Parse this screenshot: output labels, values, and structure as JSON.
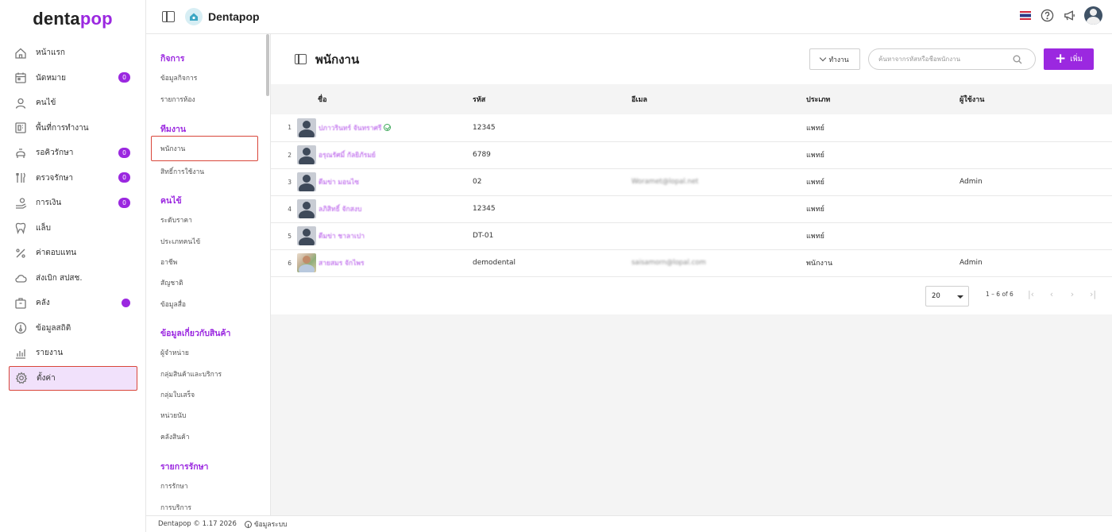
{
  "brand": {
    "logo_a": "denta",
    "logo_b": "pop"
  },
  "sidebar": {
    "items": [
      {
        "label": "หน้าแรก",
        "icon": "home-icon"
      },
      {
        "label": "นัดหมาย",
        "icon": "calendar-icon",
        "badge": "0"
      },
      {
        "label": "คนไข้",
        "icon": "user-icon"
      },
      {
        "label": "พื้นที่การทำงาน",
        "icon": "workspace-icon"
      },
      {
        "label": "รอคิวรักษา",
        "icon": "dental-chair-icon",
        "badge": "0"
      },
      {
        "label": "ตรวจรักษา",
        "icon": "tools-icon",
        "badge": "0"
      },
      {
        "label": "การเงิน",
        "icon": "payment-icon",
        "badge": "0"
      },
      {
        "label": "แล็บ",
        "icon": "tooth-icon"
      },
      {
        "label": "ค่าตอบแทน",
        "icon": "percent-icon"
      },
      {
        "label": "ส่งเบิก สปสช.",
        "icon": "cloud-icon"
      },
      {
        "label": "คลัง",
        "icon": "package-icon",
        "dot": true
      },
      {
        "label": "ข้อมูลสถิติ",
        "icon": "thermometer-icon"
      },
      {
        "label": "รายงาน",
        "icon": "report-icon"
      },
      {
        "label": "ตั้งค่า",
        "icon": "gear-icon",
        "active": true
      }
    ]
  },
  "topbar": {
    "clinic_name": "Dentapop"
  },
  "subnav": {
    "sections": [
      {
        "title": "กิจการ",
        "items": [
          "ข้อมูลกิจการ",
          "รายการห้อง"
        ]
      },
      {
        "title": "ทีมงาน",
        "items": [
          "พนักงาน",
          "สิทธิ์การใช้งาน"
        ]
      },
      {
        "title": "คนไข้",
        "items": [
          "ระดับราคา",
          "ประเภทคนไข้",
          "อาชีพ",
          "สัญชาติ",
          "ข้อมูลสื่อ"
        ]
      },
      {
        "title": "ข้อมูลเกี่ยวกับสินค้า",
        "items": [
          "ผู้จำหน่าย",
          "กลุ่มสินค้าและบริการ",
          "กลุ่มใบเสร็จ",
          "หน่วยนับ",
          "คลังสินค้า"
        ]
      },
      {
        "title": "รายการรักษา",
        "items": [
          "การรักษา",
          "การบริการ"
        ]
      }
    ]
  },
  "page": {
    "title": "พนักงาน",
    "filter_label": "ทำงาน",
    "search_placeholder": "ค้นหาจากรหัสหรือชื่อพนักงาน",
    "add_label": "เพิ่ม"
  },
  "table": {
    "headers": {
      "name": "ชื่อ",
      "code": "รหัส",
      "email": "อีเมล",
      "type": "ประเภท",
      "user": "ผู้ใช้งาน"
    },
    "rows": [
      {
        "num": "1",
        "name": "ปภาวรินทร์ จันทราศรี",
        "verified": true,
        "code": "12345",
        "email": "",
        "type": "แพทย์",
        "user": ""
      },
      {
        "num": "2",
        "name": "อรุณรัศมิ์ กัลยิภัรมย์",
        "code": "6789",
        "email": "",
        "type": "แพทย์",
        "user": ""
      },
      {
        "num": "3",
        "name": "ดีมข่า มอนไซ",
        "code": "02",
        "email": "Woramet@lopal.net",
        "type": "แพทย์",
        "user": "Admin"
      },
      {
        "num": "4",
        "name": "ลภิสิทธิ์ จักสงบ",
        "code": "12345",
        "email": "",
        "type": "แพทย์",
        "user": ""
      },
      {
        "num": "5",
        "name": "ดีมข่า ชาลาเปา",
        "code": "DT-01",
        "email": "",
        "type": "แพทย์",
        "user": ""
      },
      {
        "num": "6",
        "name": "สายสมร จักไพร",
        "photo": true,
        "code": "demodental",
        "email": "saisamorn@lopal.com",
        "type": "พนักงาน",
        "user": "Admin"
      }
    ]
  },
  "pagination": {
    "page_size": "20",
    "range": "1 – 6 of 6"
  },
  "footer": {
    "version": "Dentapop © 1.17 2026",
    "info_label": "ข้อมูลระบบ"
  },
  "colors": {
    "accent": "#9b28e0",
    "highlight_border": "#d9463a"
  }
}
